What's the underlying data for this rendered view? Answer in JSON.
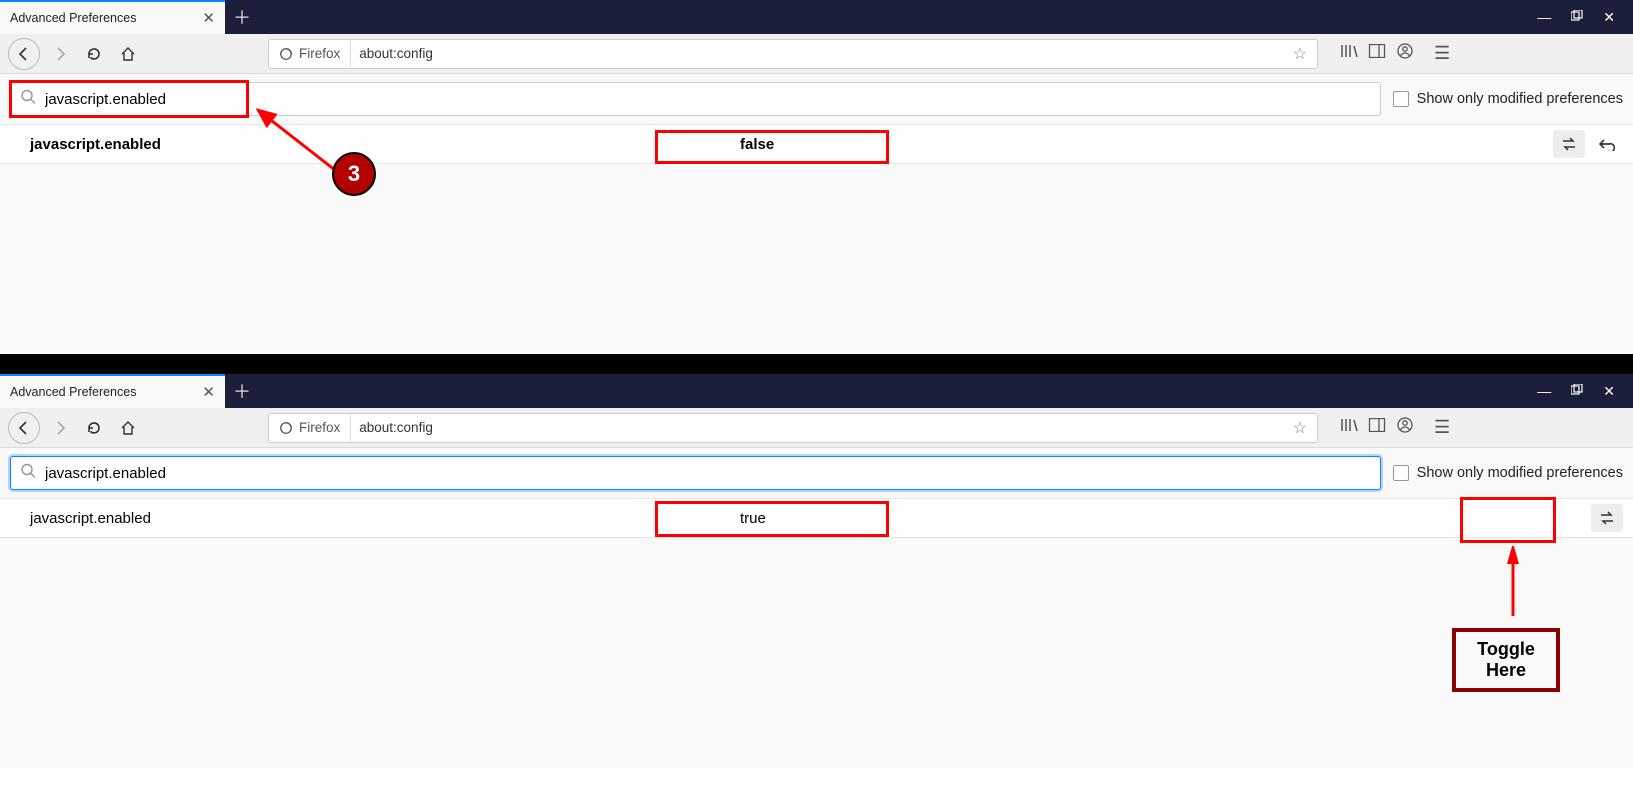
{
  "window1": {
    "tab_title": "Advanced Preferences",
    "identity_label": "Firefox",
    "url": "about:config",
    "search_value": "javascript.enabled",
    "checkbox_label": "Show only modified preferences",
    "result": {
      "name": "javascript.enabled",
      "value": "false"
    },
    "step_number": "3"
  },
  "window2": {
    "tab_title": "Advanced Preferences",
    "identity_label": "Firefox",
    "url": "about:config",
    "search_value": "javascript.enabled",
    "checkbox_label": "Show only modified preferences",
    "result": {
      "name": "javascript.enabled",
      "value": "true"
    },
    "toggle_hint": "Toggle Here"
  }
}
